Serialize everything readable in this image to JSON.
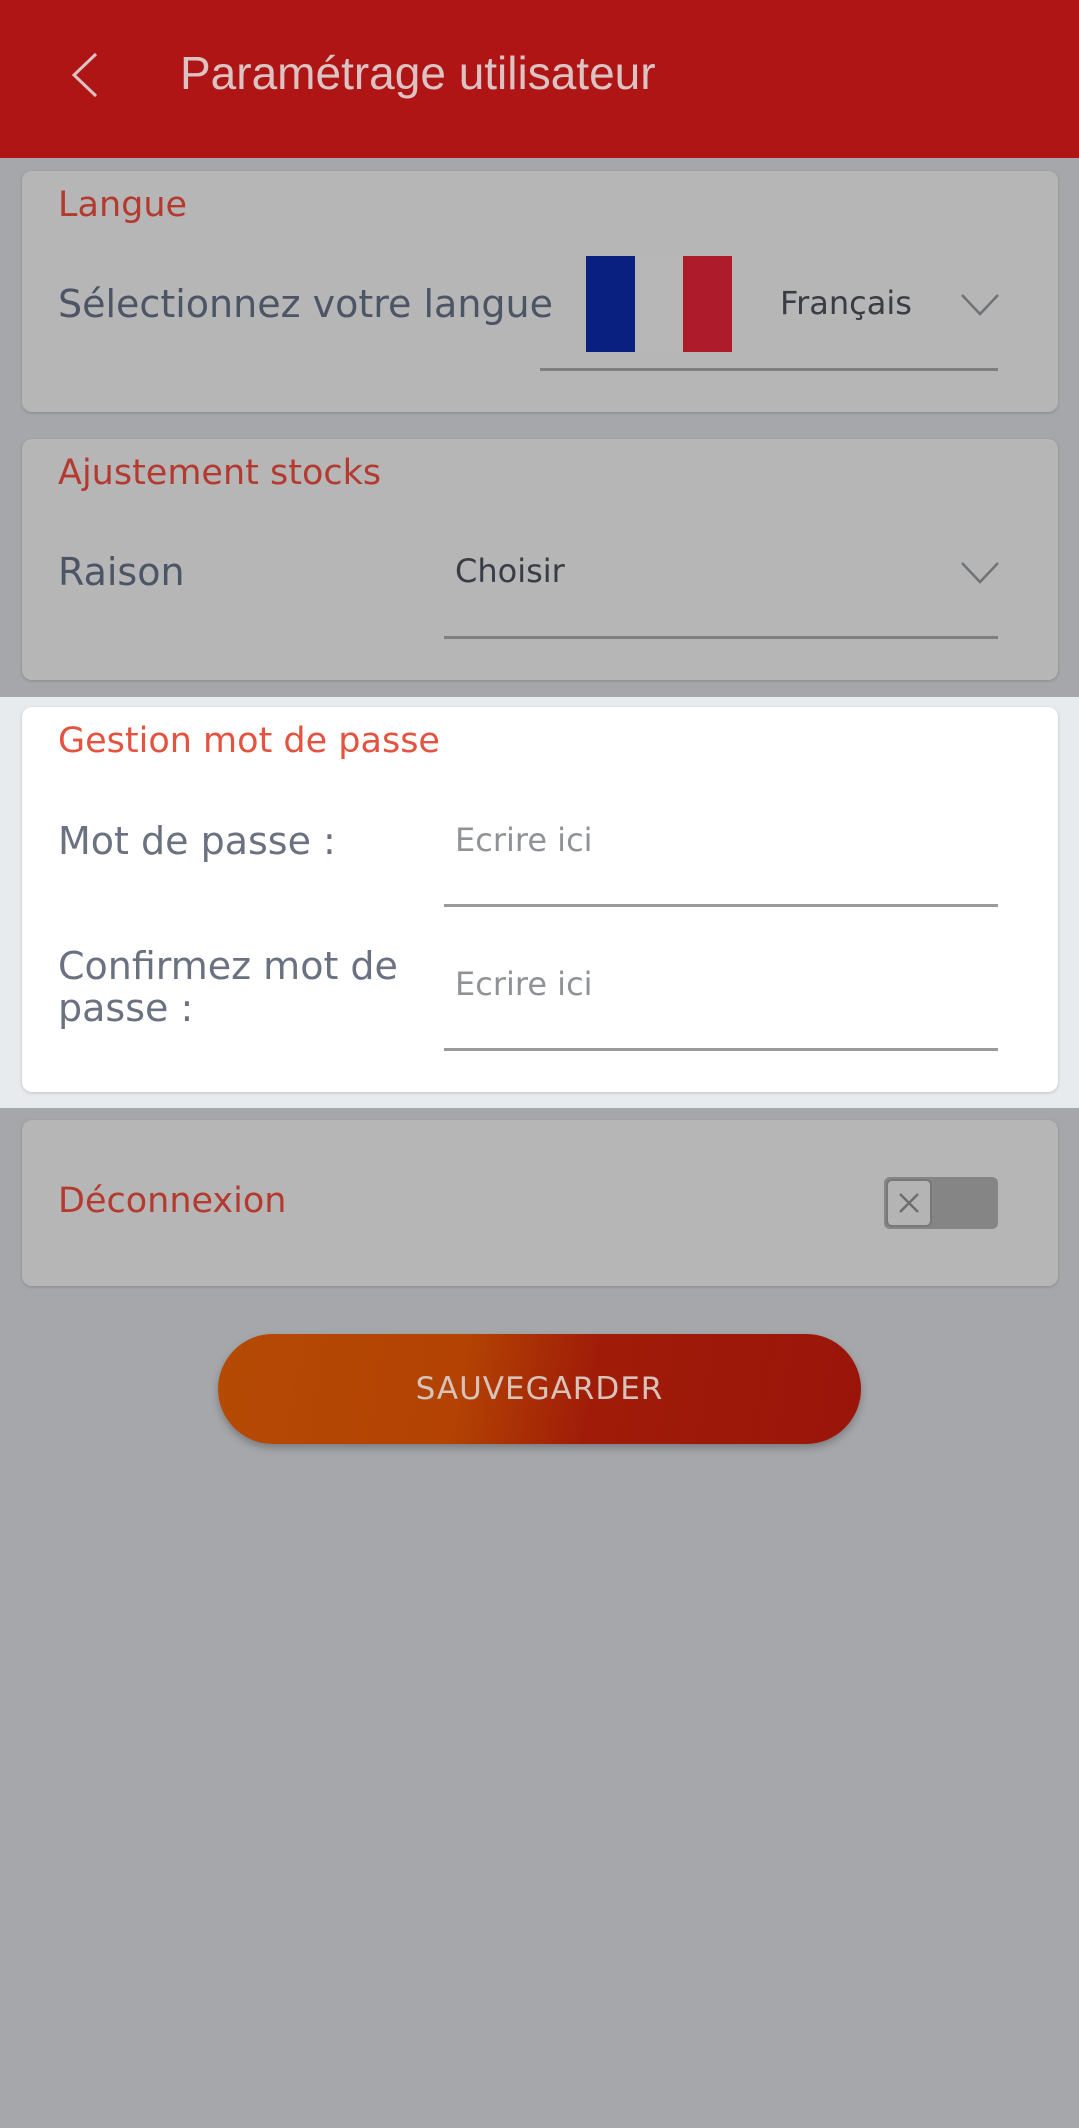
{
  "header": {
    "title": "Paramétrage utilisateur"
  },
  "language": {
    "section_title": "Langue",
    "label": "Sélectionnez votre langue",
    "selected_value": "Français",
    "flag_colors": [
      "#0a2081",
      "#b7b7b7",
      "#ae1b2b"
    ]
  },
  "stock": {
    "section_title": "Ajustement stocks",
    "label": "Raison",
    "selected_value": "Choisir"
  },
  "password": {
    "section_title": "Gestion mot de passe",
    "password_label": "Mot de passe :",
    "password_placeholder": "Ecrire ici",
    "confirm_label_line1": "Confirmez mot de",
    "confirm_label_line2": "passe :",
    "confirm_placeholder": "Ecrire ici"
  },
  "logout": {
    "label": "Déconnexion",
    "toggle_on": false
  },
  "actions": {
    "save_label": "SAUVEGARDER"
  },
  "colors": {
    "header": "#ae1514",
    "section_title": "#b43a30",
    "button_start": "#b44a04",
    "button_end": "#9b140a"
  }
}
